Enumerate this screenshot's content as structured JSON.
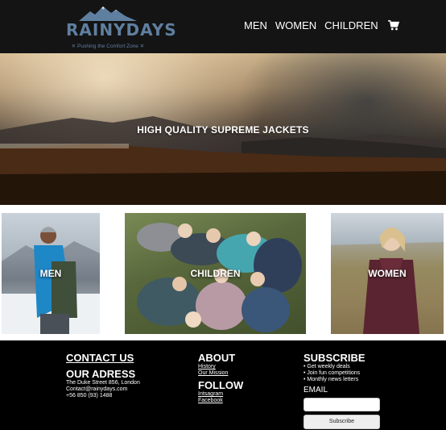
{
  "header": {
    "logo": {
      "word": "RAINYDAYS",
      "tagline": "✕ Pushing the Comfort Zone ✕"
    },
    "nav": [
      {
        "label": "MEN"
      },
      {
        "label": "WOMEN"
      },
      {
        "label": "CHILDREN"
      }
    ],
    "cart_icon": "shopping-cart-icon"
  },
  "hero": {
    "headline": "HIGH QUALITY SUPREME JACKETS"
  },
  "categories": [
    {
      "label": "MEN"
    },
    {
      "label": "CHILDREN"
    },
    {
      "label": "WOMEN"
    }
  ],
  "footer": {
    "contact_us": "CONTACT US",
    "address": {
      "heading": "OUR ADRESS",
      "lines": [
        "The Duke Street 856, London",
        "Contact@rainydays.com",
        "+56 850 (93) 1488"
      ]
    },
    "about": {
      "heading": "ABOUT",
      "links": [
        "History",
        "Our Mission"
      ]
    },
    "follow": {
      "heading": "FOLLOW",
      "links": [
        "Intsagram",
        "Facebook"
      ]
    },
    "subscribe": {
      "heading": "SUBSCRIBE",
      "bullets": [
        "• Get weekly deals",
        "• Join fun competitions",
        "• Monthly news letters"
      ],
      "email_label": "EMAIL",
      "email_value": "",
      "button_label": "Subscribe"
    }
  },
  "colors": {
    "header_bg": "#141414",
    "logo": "#5f7fa0",
    "footer_bg": "#000000",
    "text": "#ffffff"
  }
}
